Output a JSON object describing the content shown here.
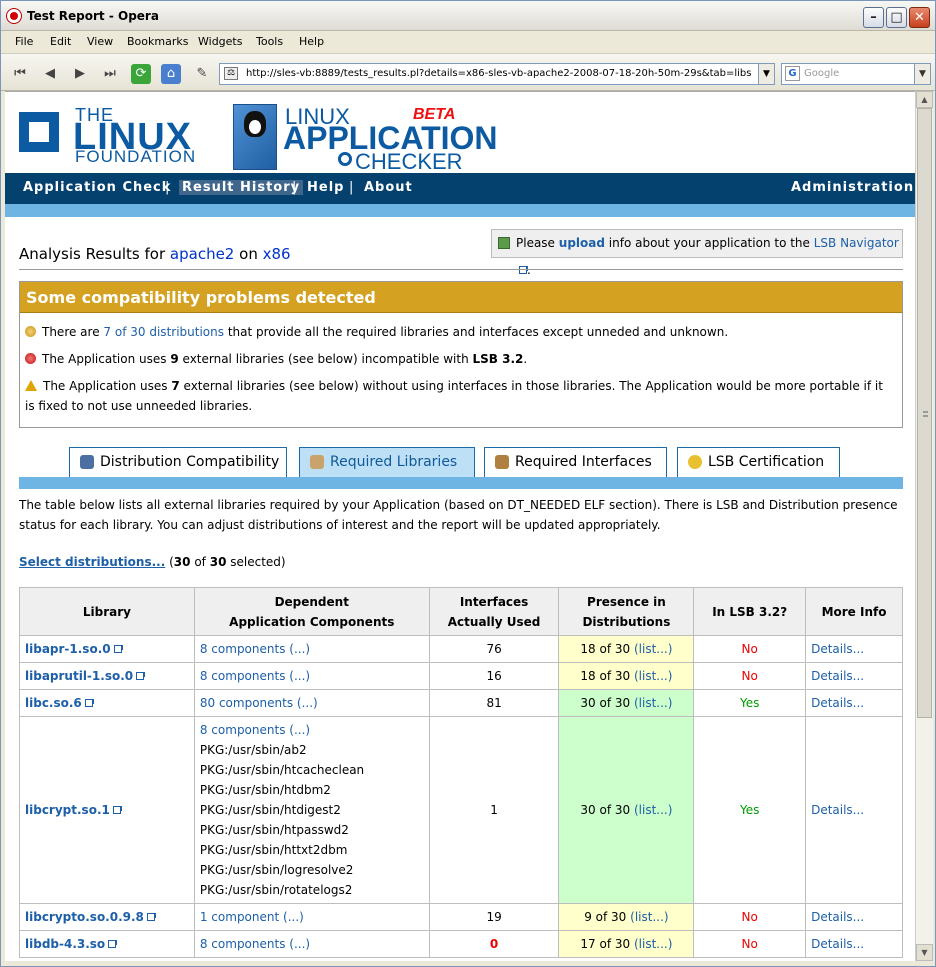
{
  "window": {
    "title": "Test Report - Opera"
  },
  "menu": [
    "File",
    "Edit",
    "View",
    "Bookmarks",
    "Widgets",
    "Tools",
    "Help"
  ],
  "address": {
    "url": "http://sles-vb:8889/tests_results.pl?details=x86-sles-vb-apache2-2008-07-18-20h-50m-29s&tab=libs"
  },
  "search": {
    "placeholder": "Google"
  },
  "header": {
    "lf_the": "THE",
    "lf_linux": "LINUX",
    "lf_foundation": "FOUNDATION",
    "lac_linux": "LINUX",
    "lac_application": "APPLICATION",
    "lac_checker": "CHECKER",
    "lac_beta": "BETA"
  },
  "nav": {
    "items": [
      "Application Check",
      "Result History",
      "Help",
      "About"
    ],
    "admin": "Administration"
  },
  "analysis": {
    "prefix": "Analysis Results for",
    "app": "apache2",
    "on": "on",
    "arch": "x86"
  },
  "upload": {
    "please": "Please",
    "upload": "upload",
    "rest": "info about your application to the",
    "link": "LSB Navigator",
    "dot": "."
  },
  "warning": {
    "title": "Some compatibility problems detected",
    "line1_a": "There are",
    "line1_link": "7 of 30",
    "line1_link2": "distributions",
    "line1_b": "that provide all the required libraries and interfaces except unneded and unknown.",
    "line2_a": "The Application uses",
    "line2_n": "9",
    "line2_b": "external libraries (see below) incompatible with",
    "line2_lsb": "LSB 3.2",
    "line2_c": ".",
    "line3_a": "The Application uses",
    "line3_n": "7",
    "line3_b": "external libraries (see below) without using interfaces in those libraries. The Application would be more portable if it is fixed to not use unneeded libraries."
  },
  "tabs": [
    "Distribution Compatibility",
    "Required Libraries",
    "Required Interfaces",
    "LSB Certification"
  ],
  "description": "The table below lists all external libraries required by your Application (based on DT_NEEDED ELF section). There is LSB and Distribution presence status for each library. You can adjust distributions of interest and the report will be updated appropriately.",
  "select": {
    "link": "Select distributions...",
    "paren_open": "(",
    "count": "30",
    "of": "of",
    "total": "30",
    "selected": "selected)"
  },
  "table": {
    "headers": [
      "Library",
      "Dependent",
      "Application Components",
      "Interfaces",
      "Actually Used",
      "Presence in",
      "Distributions",
      "In LSB 3.2?",
      "More Info"
    ],
    "rows": [
      {
        "lib": "libapr-1.so.0",
        "comp": "8 components (...)",
        "iface": "76",
        "pres": "18 of 30",
        "list": "(list...)",
        "lsb": "No",
        "more": "Details..."
      },
      {
        "lib": "libaprutil-1.so.0",
        "comp": "8 components (...)",
        "iface": "16",
        "pres": "18 of 30",
        "list": "(list...)",
        "lsb": "No",
        "more": "Details..."
      },
      {
        "lib": "libc.so.6",
        "comp": "80 components (...)",
        "iface": "81",
        "pres": "30 of 30",
        "list": "(list...)",
        "lsb": "Yes",
        "more": "Details..."
      },
      {
        "lib": "libcrypt.so.1",
        "comp": "8 components (...)",
        "iface": "1",
        "pres": "30 of 30",
        "list": "(list...)",
        "lsb": "Yes",
        "more": "Details...",
        "pkgs": [
          "PKG:/usr/sbin/ab2",
          "PKG:/usr/sbin/htcacheclean",
          "PKG:/usr/sbin/htdbm2",
          "PKG:/usr/sbin/htdigest2",
          "PKG:/usr/sbin/htpasswd2",
          "PKG:/usr/sbin/httxt2dbm",
          "PKG:/usr/sbin/logresolve2",
          "PKG:/usr/sbin/rotatelogs2"
        ]
      },
      {
        "lib": "libcrypto.so.0.9.8",
        "comp": "1 component (...)",
        "iface": "19",
        "pres": "9 of 30",
        "list": "(list...)",
        "lsb": "No",
        "more": "Details..."
      },
      {
        "lib": "libdb-4.3.so",
        "comp": "8 components (...)",
        "iface": "0",
        "pres": "17 of 30",
        "list": "(list...)",
        "lsb": "No",
        "more": "Details..."
      }
    ]
  }
}
